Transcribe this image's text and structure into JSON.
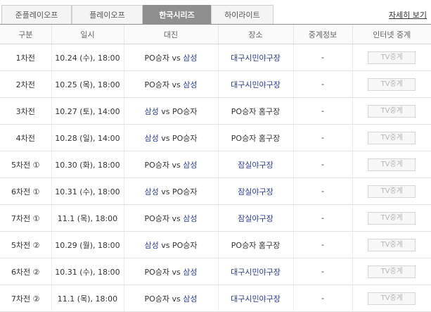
{
  "tabs": [
    "준플레이오프",
    "플레이오프",
    "한국시리즈",
    "하이라이트"
  ],
  "active_tab": 2,
  "more_link": "자세히 보기",
  "headers": [
    "구분",
    "일시",
    "대진",
    "장소",
    "중계정보",
    "인터넷 중계"
  ],
  "rows": [
    {
      "game": "1차전",
      "date": "10.24 (수), 18:00",
      "home": "PO승자",
      "away": "삼성",
      "home_blue": false,
      "away_blue": true,
      "venue": "대구시민야구장",
      "venue_blue": true,
      "broadcast": "-",
      "tv": "TV중계"
    },
    {
      "game": "2차전",
      "date": "10.25 (목), 18:00",
      "home": "PO승자",
      "away": "삼성",
      "home_blue": false,
      "away_blue": true,
      "venue": "대구시민야구장",
      "venue_blue": true,
      "broadcast": "-",
      "tv": "TV중계"
    },
    {
      "game": "3차전",
      "date": "10.27 (토), 14:00",
      "home": "삼성",
      "away": "PO승자",
      "home_blue": true,
      "away_blue": false,
      "venue": "PO승자 홈구장",
      "venue_blue": false,
      "broadcast": "-",
      "tv": "TV중계"
    },
    {
      "game": "4차전",
      "date": "10.28 (일), 14:00",
      "home": "삼성",
      "away": "PO승자",
      "home_blue": true,
      "away_blue": false,
      "venue": "PO승자 홈구장",
      "venue_blue": false,
      "broadcast": "-",
      "tv": "TV중계"
    },
    {
      "game": "5차전 ①",
      "date": "10.30 (화), 18:00",
      "home": "PO승자",
      "away": "삼성",
      "home_blue": false,
      "away_blue": true,
      "venue": "잠실야구장",
      "venue_blue": true,
      "broadcast": "-",
      "tv": "TV중계"
    },
    {
      "game": "6차전 ①",
      "date": "10.31 (수), 18:00",
      "home": "삼성",
      "away": "PO승자",
      "home_blue": true,
      "away_blue": false,
      "venue": "잠실야구장",
      "venue_blue": true,
      "broadcast": "-",
      "tv": "TV중계"
    },
    {
      "game": "7차전 ①",
      "date": "11.1 (목), 18:00",
      "home": "PO승자",
      "away": "삼성",
      "home_blue": false,
      "away_blue": true,
      "venue": "잠실야구장",
      "venue_blue": true,
      "broadcast": "-",
      "tv": "TV중계"
    },
    {
      "game": "5차전 ②",
      "date": "10.29 (월), 18:00",
      "home": "삼성",
      "away": "PO승자",
      "home_blue": true,
      "away_blue": false,
      "venue": "PO승자 홈구장",
      "venue_blue": false,
      "broadcast": "-",
      "tv": "TV중계"
    },
    {
      "game": "6차전 ②",
      "date": "10.31 (수), 18:00",
      "home": "PO승자",
      "away": "삼성",
      "home_blue": false,
      "away_blue": true,
      "venue": "대구시민야구장",
      "venue_blue": true,
      "broadcast": "-",
      "tv": "TV중계"
    },
    {
      "game": "7차전 ②",
      "date": "11.1 (목), 18:00",
      "home": "PO승자",
      "away": "삼성",
      "home_blue": false,
      "away_blue": true,
      "venue": "대구시민야구장",
      "venue_blue": true,
      "broadcast": "-",
      "tv": "TV중계"
    }
  ],
  "vs_label": "vs",
  "colors": {
    "accent_blue": "#2d3d8f",
    "active_tab_bg": "#8f8f8f"
  }
}
